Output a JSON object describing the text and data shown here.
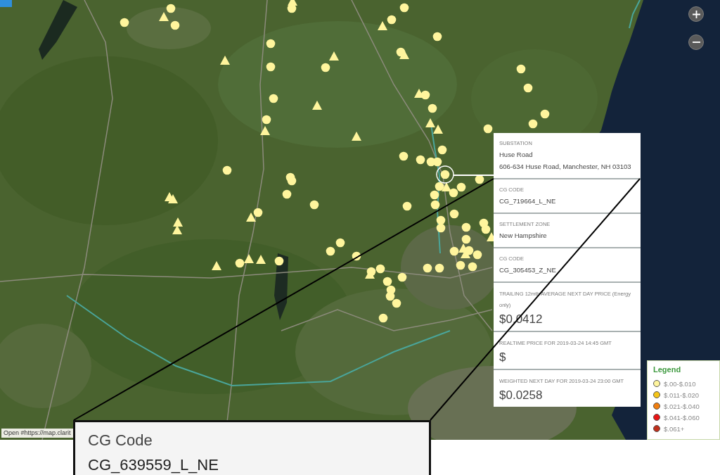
{
  "map": {
    "attribution": "Open #https://map.clarit"
  },
  "popup": {
    "sections": [
      {
        "kind": "text",
        "label": "SUBSTATION",
        "values": [
          "Huse Road",
          "606-634 Huse Road, Manchester, NH 03103"
        ]
      },
      {
        "kind": "text",
        "label": "CG CODE",
        "values": [
          "CG_719664_L_NE"
        ]
      },
      {
        "kind": "text",
        "label": "SETTLEMENT ZONE",
        "values": [
          "New Hampshire"
        ]
      },
      {
        "kind": "text",
        "label": "CG CODE",
        "values": [
          "CG_305453_Z_NE"
        ]
      },
      {
        "kind": "price",
        "label": "TRAILING 12mth AVERAGE NEXT DAY PRICE (Energy only)",
        "values": [
          "$0.0412"
        ]
      },
      {
        "kind": "price",
        "label": "REALTIME PRICE FOR 2019-03-24 14:45 GMT",
        "values": [
          "$"
        ]
      },
      {
        "kind": "price",
        "label": "WEIGHTED NEXT DAY FOR 2019-03-24 23:00 GMT",
        "values": [
          "$0.0258"
        ]
      }
    ]
  },
  "legend": {
    "title": "Legend",
    "items": [
      {
        "label": "$.00-$.010",
        "color": "#fff59d"
      },
      {
        "label": "$.011-$.020",
        "color": "#f5c518"
      },
      {
        "label": "$.021-$.040",
        "color": "#f07e10"
      },
      {
        "label": "$.041-$.060",
        "color": "#e81414"
      },
      {
        "label": "$.061+",
        "color": "#c0301c"
      }
    ]
  },
  "callout": {
    "label": "CG Code",
    "value": "CG_639559_L_NE"
  }
}
